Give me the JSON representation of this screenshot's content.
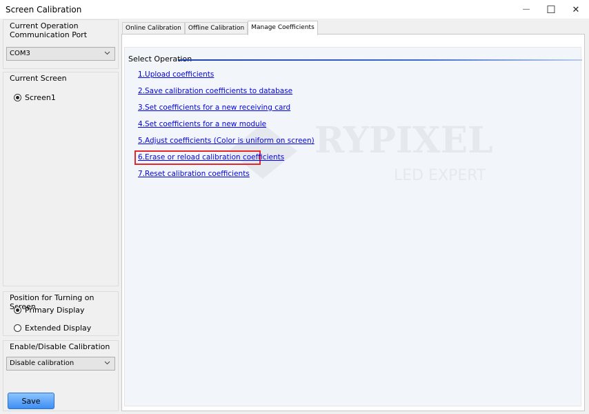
{
  "window": {
    "title": "Screen Calibration",
    "minimize_glyph": "—",
    "maximize_glyph": "☐",
    "close_glyph": "✕"
  },
  "sidebar": {
    "port_group": {
      "title": "Current Operation Communication Port",
      "selected": "COM3"
    },
    "screen_group": {
      "title": "Current Screen",
      "screen_label": "Screen1",
      "selected": true
    },
    "position_group": {
      "title": "Position for Turning on Screen",
      "options": [
        {
          "label": "Primary Display",
          "selected": true
        },
        {
          "label": "Extended Display",
          "selected": false
        }
      ]
    },
    "calibration_group": {
      "title": "Enable/Disable Calibration",
      "selected": "Disable calibration"
    },
    "save_label": "Save"
  },
  "tabs": [
    {
      "label": "Online Calibration",
      "active": false
    },
    {
      "label": "Offline Calibration",
      "active": false
    },
    {
      "label": "Manage Coefficients",
      "active": true
    }
  ],
  "manage": {
    "section_title": "Select Operation",
    "operations": [
      "1.Upload coefficients",
      "2.Save calibration coefficients to database",
      "3.Set coefficients for a new receiving card",
      "4.Set coefficients for a new module",
      "5.Adjust coefficients (Color is uniform on screen)",
      "6.Erase or reload calibration coefficients",
      "7.Reset calibration coefficients"
    ],
    "highlighted_operation_index": 5,
    "highlight_color": "#e3262a",
    "link_color": "#0000ee"
  },
  "watermark": {
    "brand": "RYPIXEL",
    "tagline": "LED EXPERT"
  }
}
